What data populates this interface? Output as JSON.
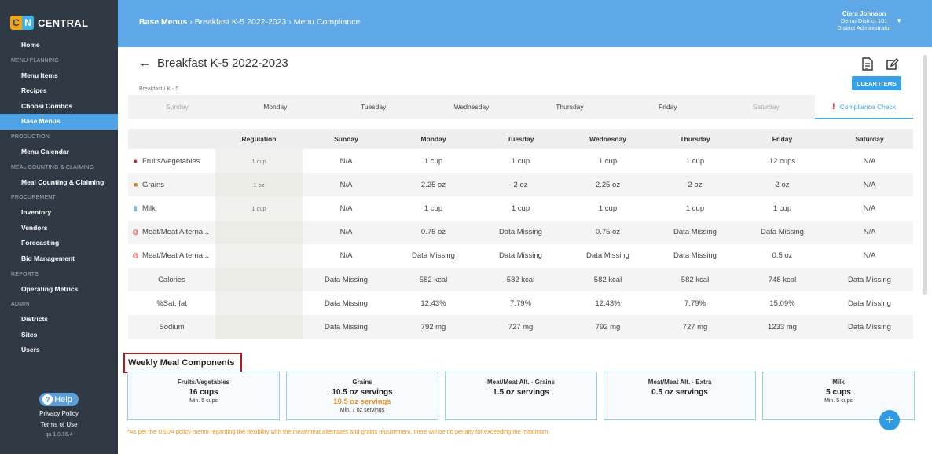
{
  "app": {
    "logo_c": "C",
    "logo_n": "N",
    "logo_text": "CENTRAL"
  },
  "sidebar": {
    "home": "Home",
    "sections": [
      {
        "title": "MENU PLANNING",
        "items": [
          "Menu Items",
          "Recipes",
          "Choosi Combos",
          "Base Menus"
        ]
      },
      {
        "title": "PRODUCTION",
        "items": [
          "Menu Calendar"
        ]
      },
      {
        "title": "MEAL COUNTING & CLAIMING",
        "items": [
          "Meal Counting & Claiming"
        ]
      },
      {
        "title": "PROCUREMENT",
        "items": [
          "Inventory",
          "Vendors",
          "Forecasting",
          "Bid Management"
        ]
      },
      {
        "title": "REPORTS",
        "items": [
          "Operating Metrics"
        ]
      },
      {
        "title": "ADMIN",
        "items": [
          "Districts",
          "Sites",
          "Users"
        ]
      }
    ],
    "active": "Base Menus",
    "help": "Help",
    "privacy": "Privacy Policy",
    "terms": "Terms of Use",
    "version": "qa 1.0.16.4"
  },
  "header": {
    "crumb1": "Base Menus",
    "crumb2": "Breakfast K-5 2022-2023",
    "crumb3": "Menu Compliance",
    "sep": "›",
    "user_name": "Ciera Johnson",
    "user_district": "Demo District 101",
    "user_role": "District Administrator"
  },
  "page": {
    "title": "Breakfast K-5 2022-2023",
    "subcrumb": "Breakfast / K - 5",
    "clear_label": "CLEAR ITEMS"
  },
  "tabs": [
    "Sunday",
    "Monday",
    "Tuesday",
    "Wednesday",
    "Thursday",
    "Friday",
    "Saturday",
    "Compliance Check"
  ],
  "table": {
    "headers": [
      "",
      "Regulation",
      "Sunday",
      "Monday",
      "Tuesday",
      "Wednesday",
      "Thursday",
      "Friday",
      "Saturday"
    ],
    "rows": [
      {
        "label": "Fruits/Vegetables",
        "icon": "apple-icon",
        "reg": "1 cup",
        "cells": [
          "N/A",
          "1 cup",
          "1 cup",
          "1 cup",
          "1 cup",
          "12 cups",
          "N/A"
        ]
      },
      {
        "label": "Grains",
        "icon": "bread-icon",
        "reg": "1 oz",
        "cells": [
          "N/A",
          "2.25 oz",
          "2 oz",
          "2.25 oz",
          "2 oz",
          "2 oz",
          "N/A"
        ]
      },
      {
        "label": "Milk",
        "icon": "milk-icon",
        "reg": "1 cup",
        "cells": [
          "N/A",
          "1 cup",
          "1 cup",
          "1 cup",
          "1 cup",
          "1 cup",
          "N/A"
        ]
      },
      {
        "label": "Meat/Meat Alterna...",
        "icon": "meat-icon",
        "reg": "",
        "cells": [
          "N/A",
          "0.75 oz",
          "Data Missing",
          "0.75 oz",
          "Data Missing",
          "Data Missing",
          "N/A"
        ]
      },
      {
        "label": "Meat/Meat Alterna...",
        "icon": "meat-icon",
        "reg": "",
        "cells": [
          "N/A",
          "Data Missing",
          "Data Missing",
          "Data Missing",
          "Data Missing",
          "0.5 oz",
          "N/A"
        ]
      },
      {
        "label": "Calories",
        "icon": "",
        "reg": "",
        "cells": [
          "Data Missing",
          "582 kcal",
          "582 kcal",
          "582 kcal",
          "582 kcal",
          "748 kcal",
          "Data Missing"
        ]
      },
      {
        "label": "%Sat. fat",
        "icon": "",
        "reg": "",
        "cells": [
          "Data Missing",
          "12.43%",
          "7.79%",
          "12.43%",
          "7.79%",
          "15.09%",
          "Data Missing"
        ]
      },
      {
        "label": "Sodium",
        "icon": "",
        "reg": "",
        "cells": [
          "Data Missing",
          "792 mg",
          "727 mg",
          "792 mg",
          "727 mg",
          "1233 mg",
          "Data Missing"
        ]
      }
    ]
  },
  "weekly": {
    "title": "Weekly Meal Components",
    "cards": [
      {
        "title": "Fruits/Vegetables",
        "value": "16 cups",
        "value2": "",
        "min": "Min. 5 cups"
      },
      {
        "title": "Grains",
        "value": "10.5 oz servings",
        "value2": "10.5 oz servings",
        "min": "Min. 7 oz servings"
      },
      {
        "title": "Meat/Meat Alt. - Grains",
        "value": "1.5 oz servings",
        "value2": "",
        "min": ""
      },
      {
        "title": "Meat/Meat Alt. - Extra",
        "value": "0.5 oz servings",
        "value2": "",
        "min": ""
      },
      {
        "title": "Milk",
        "value": "5 cups",
        "value2": "",
        "min": "Min. 5 cups"
      }
    ],
    "footnote": "*As per the USDA policy memo regarding the flexibility with the meat/meat alternates and grains requirement, there will be no penalty for exceeding the maximum"
  },
  "colors": {
    "sidebar": "#2f3a45",
    "header": "#5ea8e8",
    "active": "#4da3e6",
    "accent": "#36a2e8",
    "warning": "#f0901c"
  }
}
